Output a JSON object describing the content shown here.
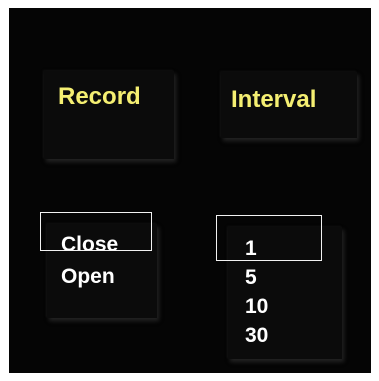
{
  "buttons": {
    "record": {
      "label": "Record"
    },
    "interval": {
      "label": "Interval"
    }
  },
  "state_list": {
    "options": [
      "Close",
      "Open"
    ],
    "selected": "Close"
  },
  "interval_list": {
    "options": [
      "1",
      "5",
      "10",
      "30"
    ],
    "selected": "1"
  },
  "colors": {
    "background": "#050505",
    "button_text": "#f5ef72",
    "list_text": "#ffffff",
    "selection_border": "#f2f2f2"
  }
}
